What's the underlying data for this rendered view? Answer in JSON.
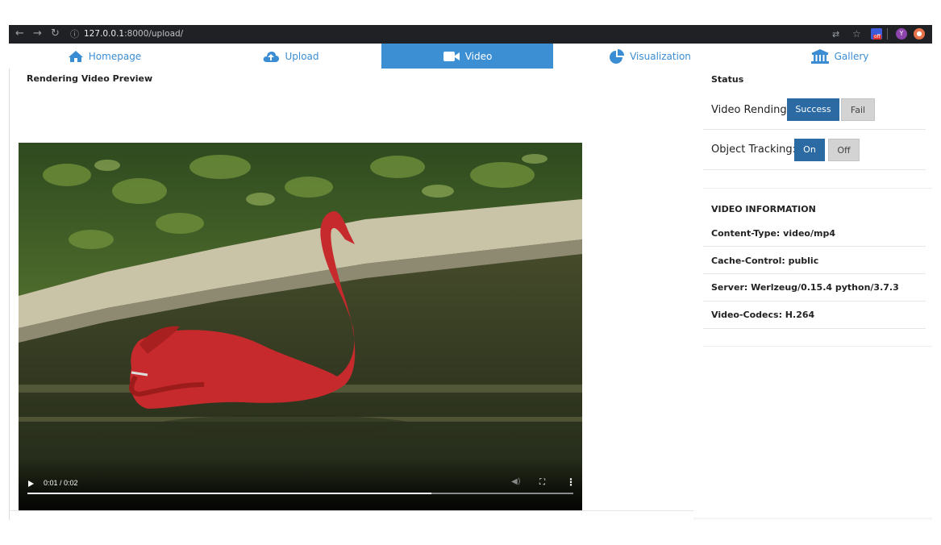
{
  "browser": {
    "url_host": "127.0.0.1",
    "url_path": ":8000/upload/",
    "ext_badge": "off",
    "avatar": "Y"
  },
  "nav": {
    "items": [
      {
        "label": "Homepage",
        "icon": "home-icon"
      },
      {
        "label": "Upload",
        "icon": "cloud-upload-icon"
      },
      {
        "label": "Video",
        "icon": "video-camera-icon",
        "active": true
      },
      {
        "label": "Visualization",
        "icon": "pie-chart-icon"
      },
      {
        "label": "Gallery",
        "icon": "bank-icon"
      }
    ]
  },
  "main": {
    "title": "Rendering Video Preview",
    "player": {
      "time": "0:01 / 0:02",
      "progress": 0.74
    }
  },
  "status": {
    "heading": "Status",
    "video_rendering": {
      "label": "Video Rending:",
      "on": "Success",
      "off": "Fail"
    },
    "object_tracking": {
      "label": "Object Tracking:",
      "on": "On",
      "off": "Off"
    }
  },
  "video_info": {
    "heading": "VIDEO INFORMATION",
    "rows": [
      "Content-Type: video/mp4",
      "Cache-Control: public",
      "Server: Werlzeug/0.15.4 python/3.7.3",
      "Video-Codecs: H.264"
    ]
  },
  "colors": {
    "nav_active": "#3d8fd4",
    "nav_text": "#3a8dd3",
    "button_on": "#2c6aa4",
    "button_off": "#d3d3d3",
    "swan_mask": "#c62a2c"
  }
}
